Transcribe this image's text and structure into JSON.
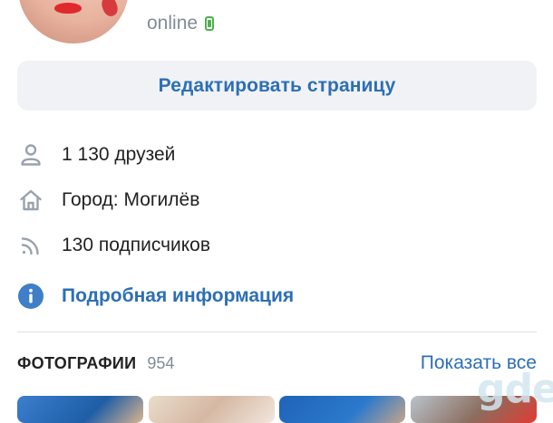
{
  "profile": {
    "status": "online"
  },
  "edit_button": {
    "label": "Редактировать страницу"
  },
  "info": {
    "friends": "1 130 друзей",
    "city": "Город: Могилёв",
    "subscribers": "130 подписчиков",
    "more": "Подробная информация"
  },
  "photos": {
    "title": "ФОТОГРАФИИ",
    "count": "954",
    "show_all": "Показать все"
  },
  "watermark": "gde",
  "colors": {
    "accent": "#2d6fb5",
    "online": "#4bb34b",
    "secondary_text": "#818c99",
    "button_bg": "#f0f2f5"
  },
  "icons": {
    "friends": "person-icon",
    "city": "house-icon",
    "subscribers": "rss-icon",
    "more": "info-icon",
    "status": "mobile-phone-icon"
  }
}
